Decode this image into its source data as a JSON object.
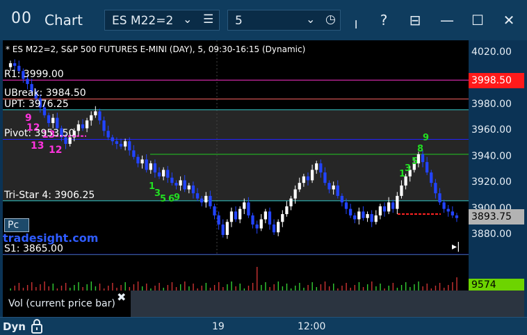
{
  "window": {
    "app_icon": "00",
    "title": "Chart",
    "symbol": "ES M22=2",
    "interval": "5",
    "icons": {
      "symbol_dropdown": "chevron-down-icon",
      "symbol_menu": "menu-icon",
      "interval_dropdown": "chevron-down-icon",
      "interval_clock": "clock-icon",
      "pin": "pin-icon",
      "help": "help-icon",
      "template": "template-icon",
      "minimize": "minimize-icon",
      "maximize": "maximize-icon",
      "close": "close-icon"
    },
    "labels": {
      "chev": "⌄",
      "menu": "☰",
      "clock": "◷",
      "pin": "╷",
      "help": "?",
      "template": "⊟",
      "minimize": "—",
      "maximize": "☐",
      "close": "✕"
    }
  },
  "chart": {
    "header": "* ES M22=2, S&P 500 FUTURES E-MINI (DAY), 5, 09:30-16:15 (Dynamic)",
    "levels": [
      {
        "name": "r1",
        "label": "R1: 3999.00",
        "price": 3999.0,
        "color": "#ff33cc"
      },
      {
        "name": "ubreak",
        "label": "UBreak: 3984.50",
        "price": 3984.5,
        "color": "#ff6666"
      },
      {
        "name": "upt",
        "label": "UPT: 3976.25",
        "price": 3976.25,
        "color": "#33cccc"
      },
      {
        "name": "pivot",
        "label": "Pivot: 3953.50",
        "price": 3953.5,
        "color": "#2222ff"
      },
      {
        "name": "tristar",
        "label": "Tri-Star 4: 3906.25",
        "price": 3906.25,
        "color": "#33cccc"
      },
      {
        "name": "s1",
        "label": "S1: 3865.00",
        "price": 3865.0,
        "color": "#2222ff"
      }
    ],
    "pc_button": "Pc",
    "watermark": "tradesight.com",
    "scroll_end_icon": "scroll-to-end-icon",
    "scroll_end_glyph": "▸|",
    "price_ticks": [
      "4020.00",
      "3980.00",
      "3960.00",
      "3940.00",
      "3920.00",
      "3900.00",
      "3880.00"
    ],
    "price_flag_red": "3998.50",
    "price_flag_last": "3893.75",
    "colors": {
      "up_bar": "#ffffff",
      "down_bar": "#2244ff",
      "green_line": "#22cc22",
      "shade": "#262626",
      "red_flag": "#ff1a1a",
      "last_flag": "#b3b3b3",
      "setup_green": "#22dd22",
      "setup_magenta": "#ff33dd"
    }
  },
  "chart_data": {
    "type": "candlestick",
    "title": "* ES M22=2, S&P 500 FUTURES E-MINI (DAY), 5, 09:30-16:15 (Dynamic)",
    "ylim": [
      3865,
      4025
    ],
    "yticks": [
      3880,
      3900,
      3920,
      3940,
      3960,
      3980,
      4020
    ],
    "x_ticks": [
      "19",
      "12:00"
    ],
    "closes": [
      4012,
      4010,
      4006,
      4000,
      3996,
      3990,
      3985,
      3978,
      3972,
      3966,
      3970,
      3962,
      3955,
      3950,
      3955,
      3960,
      3965,
      3962,
      3968,
      3972,
      3975,
      3968,
      3960,
      3955,
      3952,
      3950,
      3948,
      3952,
      3945,
      3940,
      3935,
      3938,
      3930,
      3935,
      3928,
      3925,
      3930,
      3924,
      3920,
      3918,
      3922,
      3915,
      3918,
      3912,
      3908,
      3905,
      3910,
      3902,
      3895,
      3888,
      3880,
      3890,
      3898,
      3892,
      3900,
      3905,
      3895,
      3888,
      3885,
      3892,
      3898,
      3888,
      3882,
      3890,
      3896,
      3902,
      3908,
      3915,
      3920,
      3925,
      3922,
      3930,
      3935,
      3928,
      3920,
      3915,
      3918,
      3910,
      3905,
      3900,
      3895,
      3892,
      3898,
      3893,
      3896,
      3890,
      3895,
      3902,
      3898,
      3905,
      3900,
      3910,
      3918,
      3925,
      3930,
      3935,
      3942,
      3936,
      3928,
      3920,
      3912,
      3905,
      3900,
      3898,
      3895,
      3893
    ],
    "setup_counts": {
      "magenta": [
        "9",
        "12",
        "13",
        "12",
        "13"
      ],
      "green": [
        "1",
        "3",
        "5",
        "6",
        "9",
        "1",
        "3",
        "5",
        "8",
        "9"
      ]
    },
    "volume_last": "9574"
  },
  "volume": {
    "flag": "9574",
    "label": "Vol (current price bar)",
    "close_icon": "close-icon",
    "close_glyph": "✖"
  },
  "timebar": {
    "dyn": "Dyn",
    "lock_icon": "lock-icon",
    "ticks": [
      "19",
      "12:00"
    ]
  }
}
